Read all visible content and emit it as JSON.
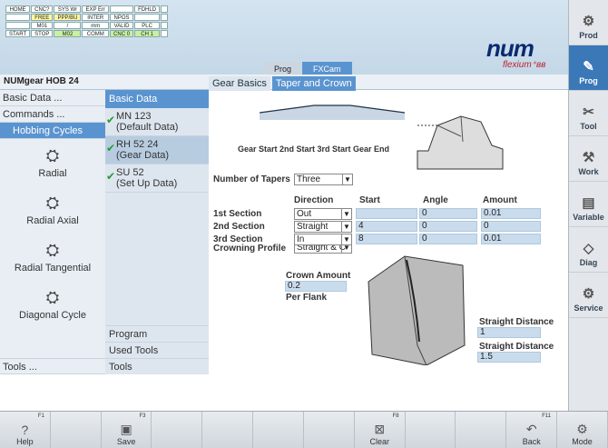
{
  "status": [
    [
      "HOME",
      "CNC?",
      "SYS Wr",
      "EXP Err",
      "",
      "FDHLD",
      ""
    ],
    [
      "",
      "FREE",
      "PPP/BU",
      "INTER",
      "NPOS",
      "",
      ""
    ],
    [
      "",
      "M01",
      "/",
      "mm",
      "VALID",
      "PLC",
      ""
    ],
    [
      "START",
      "STOP",
      "M02",
      "COMM",
      "CNC 0",
      "CH 1",
      ""
    ]
  ],
  "logo": "num",
  "logo_sub": "flexium⁺ʙв",
  "breadcrumb": [
    "Prog",
    "FXCam"
  ],
  "page_title": "NUMgear HOB 24",
  "right_menu": [
    {
      "label": "Prod",
      "icon": "⚙"
    },
    {
      "label": "Prog",
      "icon": "✎"
    },
    {
      "label": "Tool",
      "icon": "✂"
    },
    {
      "label": "Work",
      "icon": "⚒"
    },
    {
      "label": "Variable",
      "icon": "▤"
    },
    {
      "label": "Diag",
      "icon": "◇"
    },
    {
      "label": "Service",
      "icon": "⚙"
    }
  ],
  "left": {
    "basic": "Basic Data ...",
    "commands": "Commands ...",
    "hobbing": "Hobbing Cycles",
    "cycles": [
      "Radial",
      "Radial Axial",
      "Radial Tangential",
      "Diagonal Cycle"
    ],
    "tools": "Tools ..."
  },
  "mid": {
    "header": "Basic Data",
    "items": [
      [
        "MN 123",
        "(Default Data)"
      ],
      [
        "RH 52 24",
        "(Gear Data)"
      ],
      [
        "SU 52",
        "(Set Up Data)"
      ]
    ],
    "bottom": [
      "Program",
      "Used Tools",
      "Tools"
    ]
  },
  "tabs": [
    "Gear Basics",
    "Taper and Crown"
  ],
  "panel": {
    "stages": "Gear Start  2nd Start   3rd Start    Gear End",
    "num_tapers_label": "Number of Tapers",
    "num_tapers": "Three",
    "col_dir": "Direction",
    "col_start": "Start",
    "col_angle": "Angle",
    "col_amount": "Amount",
    "sections": [
      {
        "label": "1st Section",
        "dir": "Out",
        "start": "",
        "angle": "0",
        "amount": "0.01"
      },
      {
        "label": "2nd Section",
        "dir": "Straight",
        "start": "4",
        "angle": "0",
        "amount": "0"
      },
      {
        "label": "3rd Section",
        "dir": "In",
        "start": "8",
        "angle": "0",
        "amount": "0.01"
      }
    ],
    "crown_label": "Crowning Profile",
    "crown": "Straight & C",
    "crown_amt_label": "Crown Amount",
    "crown_amt": "0.2",
    "per_flank": "Per Flank",
    "sd_label": "Straight Distance",
    "sd1": "1",
    "sd2": "1.5"
  },
  "fkeys": [
    {
      "n": "F1",
      "label": "Help",
      "icon": "?"
    },
    {
      "n": "",
      "label": "",
      "icon": ""
    },
    {
      "n": "F3",
      "label": "Save",
      "icon": "▣"
    },
    {
      "n": "",
      "label": "",
      "icon": ""
    },
    {
      "n": "",
      "label": "",
      "icon": ""
    },
    {
      "n": "",
      "label": "",
      "icon": ""
    },
    {
      "n": "",
      "label": "",
      "icon": ""
    },
    {
      "n": "F8",
      "label": "Clear",
      "icon": "⊠"
    },
    {
      "n": "",
      "label": "",
      "icon": ""
    },
    {
      "n": "",
      "label": "",
      "icon": ""
    },
    {
      "n": "F11",
      "label": "Back",
      "icon": "↶"
    },
    {
      "n": "",
      "label": "Mode",
      "icon": "⚙"
    }
  ]
}
